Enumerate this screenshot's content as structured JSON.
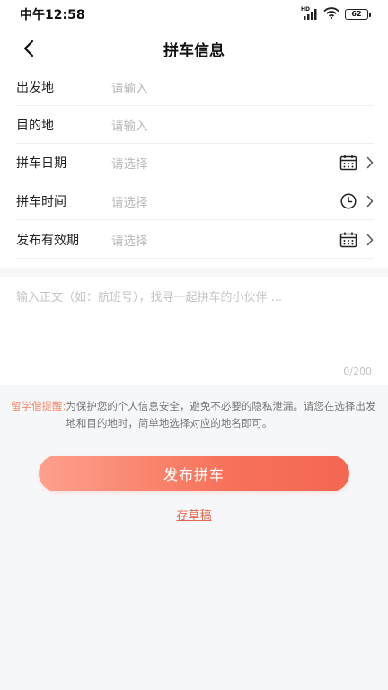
{
  "status_bar": {
    "time": "中午12:58",
    "network_label": "HD",
    "battery": "62"
  },
  "header": {
    "title": "拼车信息"
  },
  "form": {
    "rows": [
      {
        "label": "出发地",
        "placeholder": "请输入"
      },
      {
        "label": "目的地",
        "placeholder": "请输入"
      },
      {
        "label": "拼车日期",
        "placeholder": "请选择",
        "icon": "calendar-icon"
      },
      {
        "label": "拼车时间",
        "placeholder": "请选择",
        "icon": "clock-icon"
      },
      {
        "label": "发布有效期",
        "placeholder": "请选择",
        "icon": "calendar-icon"
      }
    ]
  },
  "description": {
    "placeholder": "输入正文（如：航班号），找寻一起拼车的小伙伴 ...",
    "counter": "0/200"
  },
  "notice": {
    "label": "留学偕提醒:",
    "text": "为保护您的个人信息安全，避免不必要的隐私泄漏。请您在选择出发地和目的地时，简单地选择对应的地名即可。"
  },
  "actions": {
    "publish_label": "发布拼车",
    "draft_label": "存草稿"
  },
  "colors": {
    "accent": "#f4705a",
    "accent_light": "#fda08c",
    "notice_label": "#ee8a6c",
    "background": "#f6f7f9"
  }
}
